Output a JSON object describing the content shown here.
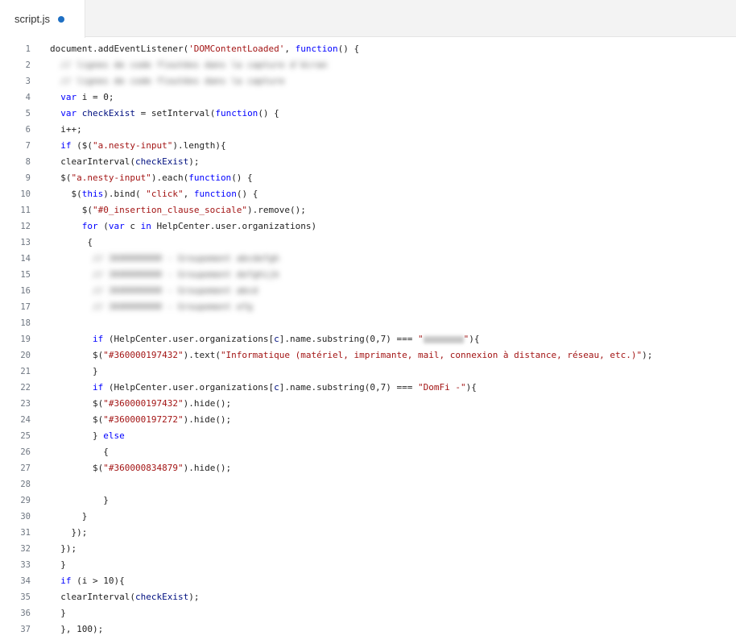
{
  "tab": {
    "filename": "script.js",
    "dirty_indicator": "unsaved-dot"
  },
  "lines": [
    [
      {
        "t": "document.addEventListener(",
        "c": ""
      },
      {
        "t": "'DOMContentLoaded'",
        "c": "s"
      },
      {
        "t": ", ",
        "c": ""
      },
      {
        "t": "function",
        "c": "k"
      },
      {
        "t": "() {",
        "c": ""
      }
    ],
    [
      {
        "t": "  // lignes de code floutées dans la capture d'écran",
        "c": "blur"
      }
    ],
    [
      {
        "t": "  // lignes de code floutées dans la capture",
        "c": "blur"
      }
    ],
    [
      {
        "t": "  ",
        "c": ""
      },
      {
        "t": "var",
        "c": "k"
      },
      {
        "t": " i = 0;",
        "c": ""
      }
    ],
    [
      {
        "t": "  ",
        "c": ""
      },
      {
        "t": "var",
        "c": "k"
      },
      {
        "t": " ",
        "c": ""
      },
      {
        "t": "checkExist",
        "c": "v"
      },
      {
        "t": " = setInterval(",
        "c": ""
      },
      {
        "t": "function",
        "c": "k"
      },
      {
        "t": "() {",
        "c": ""
      }
    ],
    [
      {
        "t": "  i++;",
        "c": ""
      }
    ],
    [
      {
        "t": "  ",
        "c": ""
      },
      {
        "t": "if",
        "c": "k"
      },
      {
        "t": " ($(",
        "c": ""
      },
      {
        "t": "\"a.nesty-input\"",
        "c": "s"
      },
      {
        "t": ").length){",
        "c": ""
      }
    ],
    [
      {
        "t": "  clearInterval(",
        "c": ""
      },
      {
        "t": "checkExist",
        "c": "v"
      },
      {
        "t": ");",
        "c": ""
      }
    ],
    [
      {
        "t": "  $(",
        "c": ""
      },
      {
        "t": "\"a.nesty-input\"",
        "c": "s"
      },
      {
        "t": ").each(",
        "c": ""
      },
      {
        "t": "function",
        "c": "k"
      },
      {
        "t": "() {",
        "c": ""
      }
    ],
    [
      {
        "t": "    $(",
        "c": ""
      },
      {
        "t": "this",
        "c": "k"
      },
      {
        "t": ").bind( ",
        "c": ""
      },
      {
        "t": "\"click\"",
        "c": "s"
      },
      {
        "t": ", ",
        "c": ""
      },
      {
        "t": "function",
        "c": "k"
      },
      {
        "t": "() {",
        "c": ""
      }
    ],
    [
      {
        "t": "      $(",
        "c": ""
      },
      {
        "t": "\"#0_insertion_clause_sociale\"",
        "c": "s"
      },
      {
        "t": ").remove();",
        "c": ""
      }
    ],
    [
      {
        "t": "      ",
        "c": ""
      },
      {
        "t": "for",
        "c": "k"
      },
      {
        "t": " (",
        "c": ""
      },
      {
        "t": "var",
        "c": "k"
      },
      {
        "t": " c ",
        "c": ""
      },
      {
        "t": "in",
        "c": "k"
      },
      {
        "t": " HelpCenter.user.organizations)",
        "c": ""
      }
    ],
    [
      {
        "t": "       {",
        "c": ""
      }
    ],
    [
      {
        "t": "        // 3600000000 - Groupement abcdefgh",
        "c": "blur"
      }
    ],
    [
      {
        "t": "        // 3600000000 - Groupement defghijk",
        "c": "blur"
      }
    ],
    [
      {
        "t": "        // 3600000000 - Groupement abcd",
        "c": "blur"
      }
    ],
    [
      {
        "t": "        // 3600000000 - Groupement efg",
        "c": "blur"
      }
    ],
    [
      {
        "t": "",
        "c": ""
      }
    ],
    [
      {
        "t": "        ",
        "c": ""
      },
      {
        "t": "if",
        "c": "k"
      },
      {
        "t": " (HelpCenter.user.organizations[",
        "c": ""
      },
      {
        "t": "c",
        "c": "v"
      },
      {
        "t": "].name.substring(0,7) === ",
        "c": ""
      },
      {
        "t": "\"",
        "c": "s"
      },
      {
        "t": "",
        "c": "redact"
      },
      {
        "t": "\"",
        "c": "s"
      },
      {
        "t": "){",
        "c": ""
      }
    ],
    [
      {
        "t": "        $(",
        "c": ""
      },
      {
        "t": "\"#360000197432\"",
        "c": "s"
      },
      {
        "t": ").text(",
        "c": ""
      },
      {
        "t": "\"Informatique (matériel, imprimante, mail, connexion à distance, réseau, etc.)\"",
        "c": "s"
      },
      {
        "t": ");",
        "c": ""
      }
    ],
    [
      {
        "t": "        }",
        "c": ""
      }
    ],
    [
      {
        "t": "        ",
        "c": ""
      },
      {
        "t": "if",
        "c": "k"
      },
      {
        "t": " (HelpCenter.user.organizations[",
        "c": ""
      },
      {
        "t": "c",
        "c": "v"
      },
      {
        "t": "].name.substring(0,7) === ",
        "c": ""
      },
      {
        "t": "\"DomFi -\"",
        "c": "s"
      },
      {
        "t": "){",
        "c": ""
      }
    ],
    [
      {
        "t": "        $(",
        "c": ""
      },
      {
        "t": "\"#360000197432\"",
        "c": "s"
      },
      {
        "t": ").hide();",
        "c": ""
      }
    ],
    [
      {
        "t": "        $(",
        "c": ""
      },
      {
        "t": "\"#360000197272\"",
        "c": "s"
      },
      {
        "t": ").hide();",
        "c": ""
      }
    ],
    [
      {
        "t": "        } ",
        "c": ""
      },
      {
        "t": "else",
        "c": "k"
      }
    ],
    [
      {
        "t": "          {",
        "c": ""
      }
    ],
    [
      {
        "t": "        $(",
        "c": ""
      },
      {
        "t": "\"#360000834879\"",
        "c": "s"
      },
      {
        "t": ").hide();",
        "c": ""
      }
    ],
    [
      {
        "t": "",
        "c": ""
      }
    ],
    [
      {
        "t": "          }",
        "c": ""
      }
    ],
    [
      {
        "t": "      }",
        "c": ""
      }
    ],
    [
      {
        "t": "    });",
        "c": ""
      }
    ],
    [
      {
        "t": "  });",
        "c": ""
      }
    ],
    [
      {
        "t": "  }",
        "c": ""
      }
    ],
    [
      {
        "t": "  ",
        "c": ""
      },
      {
        "t": "if",
        "c": "k"
      },
      {
        "t": " (i > 10){",
        "c": ""
      }
    ],
    [
      {
        "t": "  clearInterval(",
        "c": ""
      },
      {
        "t": "checkExist",
        "c": "v"
      },
      {
        "t": ");",
        "c": ""
      }
    ],
    [
      {
        "t": "  }",
        "c": ""
      }
    ],
    [
      {
        "t": "  }, 100);",
        "c": ""
      }
    ]
  ]
}
